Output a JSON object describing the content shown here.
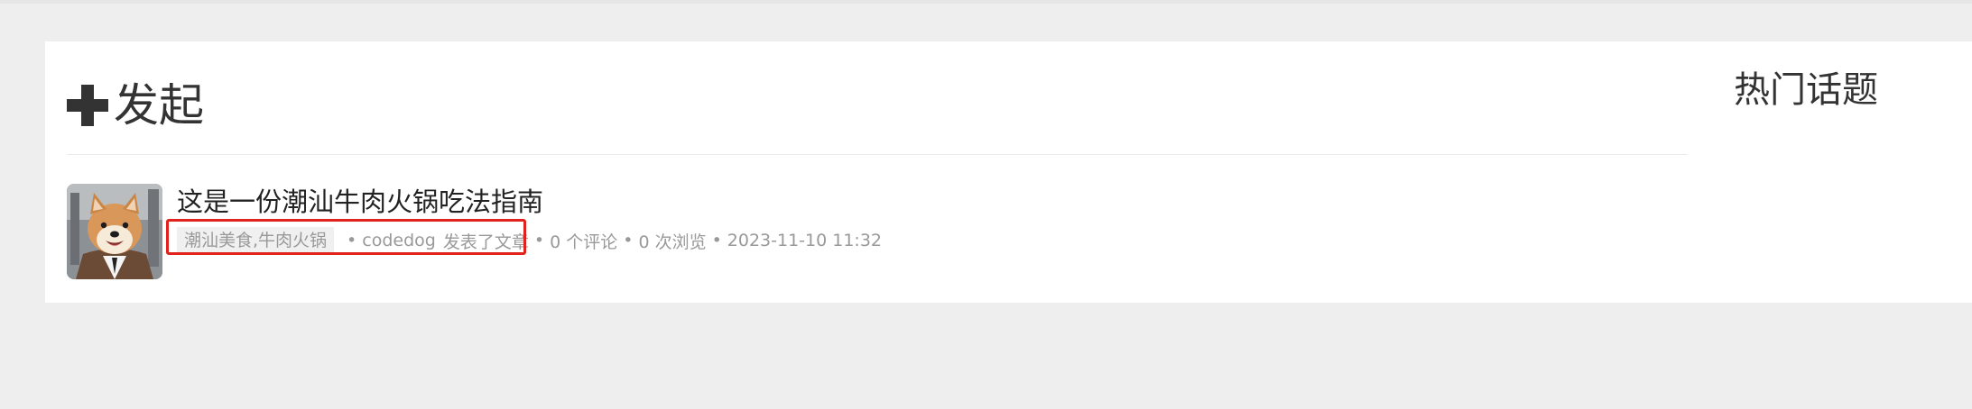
{
  "publish": {
    "label": "发起",
    "icon": "plus-icon"
  },
  "feed": {
    "items": [
      {
        "title": "这是一份潮汕牛肉火锅吃法指南",
        "tag": "潮汕美食,牛肉火锅",
        "author": "codedog",
        "action": "发表了文章",
        "comments": "0 个评论",
        "views": "0 次浏览",
        "datetime": "2023-11-10 11:32",
        "separator": "•",
        "avatar": "shiba-dog-avatar"
      }
    ]
  },
  "sidebar": {
    "title": "热门话题"
  },
  "colors": {
    "background": "#eeeeee",
    "panel": "#ffffff",
    "highlight": "#e0231c",
    "meta_text": "#999999",
    "title_text": "#222222"
  }
}
